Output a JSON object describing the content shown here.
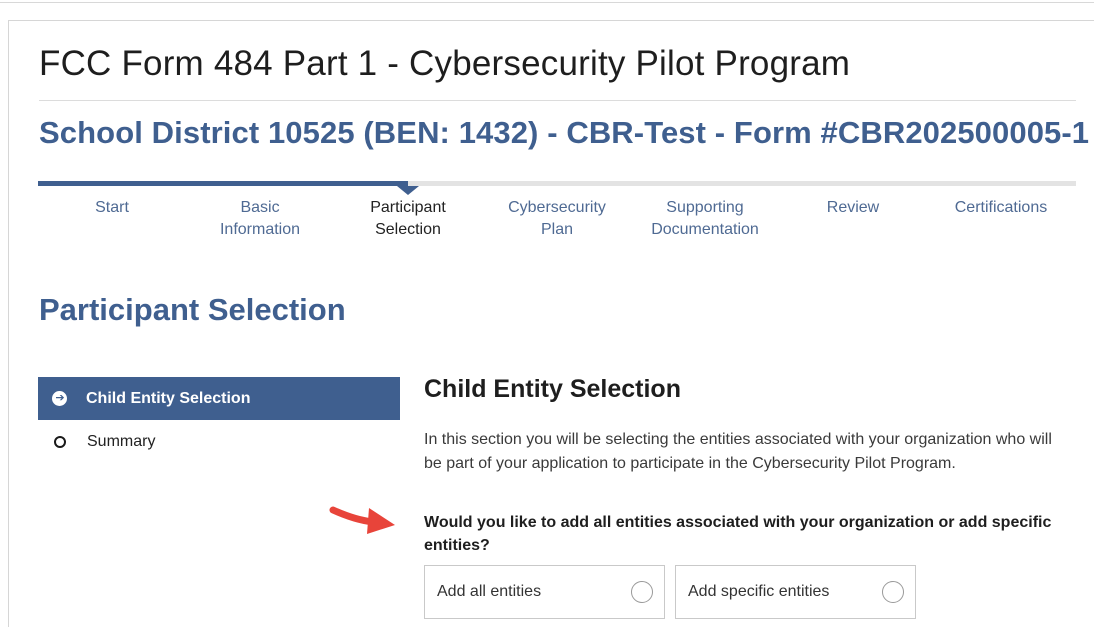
{
  "header": {
    "form_title": "FCC Form 484 Part 1 - Cybersecurity Pilot Program",
    "subtitle": "School District 10525 (BEN: 1432) - CBR-Test - Form #CBR202500005-1"
  },
  "stepper": {
    "active_index": 2,
    "steps": [
      {
        "line1": "Start",
        "line2": ""
      },
      {
        "line1": "Basic",
        "line2": "Information"
      },
      {
        "line1": "Participant",
        "line2": "Selection"
      },
      {
        "line1": "Cybersecurity",
        "line2": "Plan"
      },
      {
        "line1": "Supporting",
        "line2": "Documentation"
      },
      {
        "line1": "Review",
        "line2": ""
      },
      {
        "line1": "Certifications",
        "line2": ""
      }
    ]
  },
  "section": {
    "title": "Participant Selection"
  },
  "sidenav": {
    "items": [
      {
        "label": "Child Entity Selection",
        "icon": "arrow-right-circle-icon",
        "active": true
      },
      {
        "label": "Summary",
        "icon": "circle-outline-icon",
        "active": false
      }
    ]
  },
  "content": {
    "title": "Child Entity Selection",
    "description": "In this section you will be selecting the entities associated with your organization who will be part of your application to participate in the Cybersecurity Pilot Program.",
    "question": "Would you like to add all entities associated with your organization or add specific entities?",
    "options": [
      {
        "label": "Add all entities",
        "selected": false
      },
      {
        "label": "Add specific entities",
        "selected": false
      }
    ]
  },
  "colors": {
    "primary": "#3f5f8f",
    "annotation_arrow": "#e8443a",
    "track": "#e3e3e3"
  }
}
